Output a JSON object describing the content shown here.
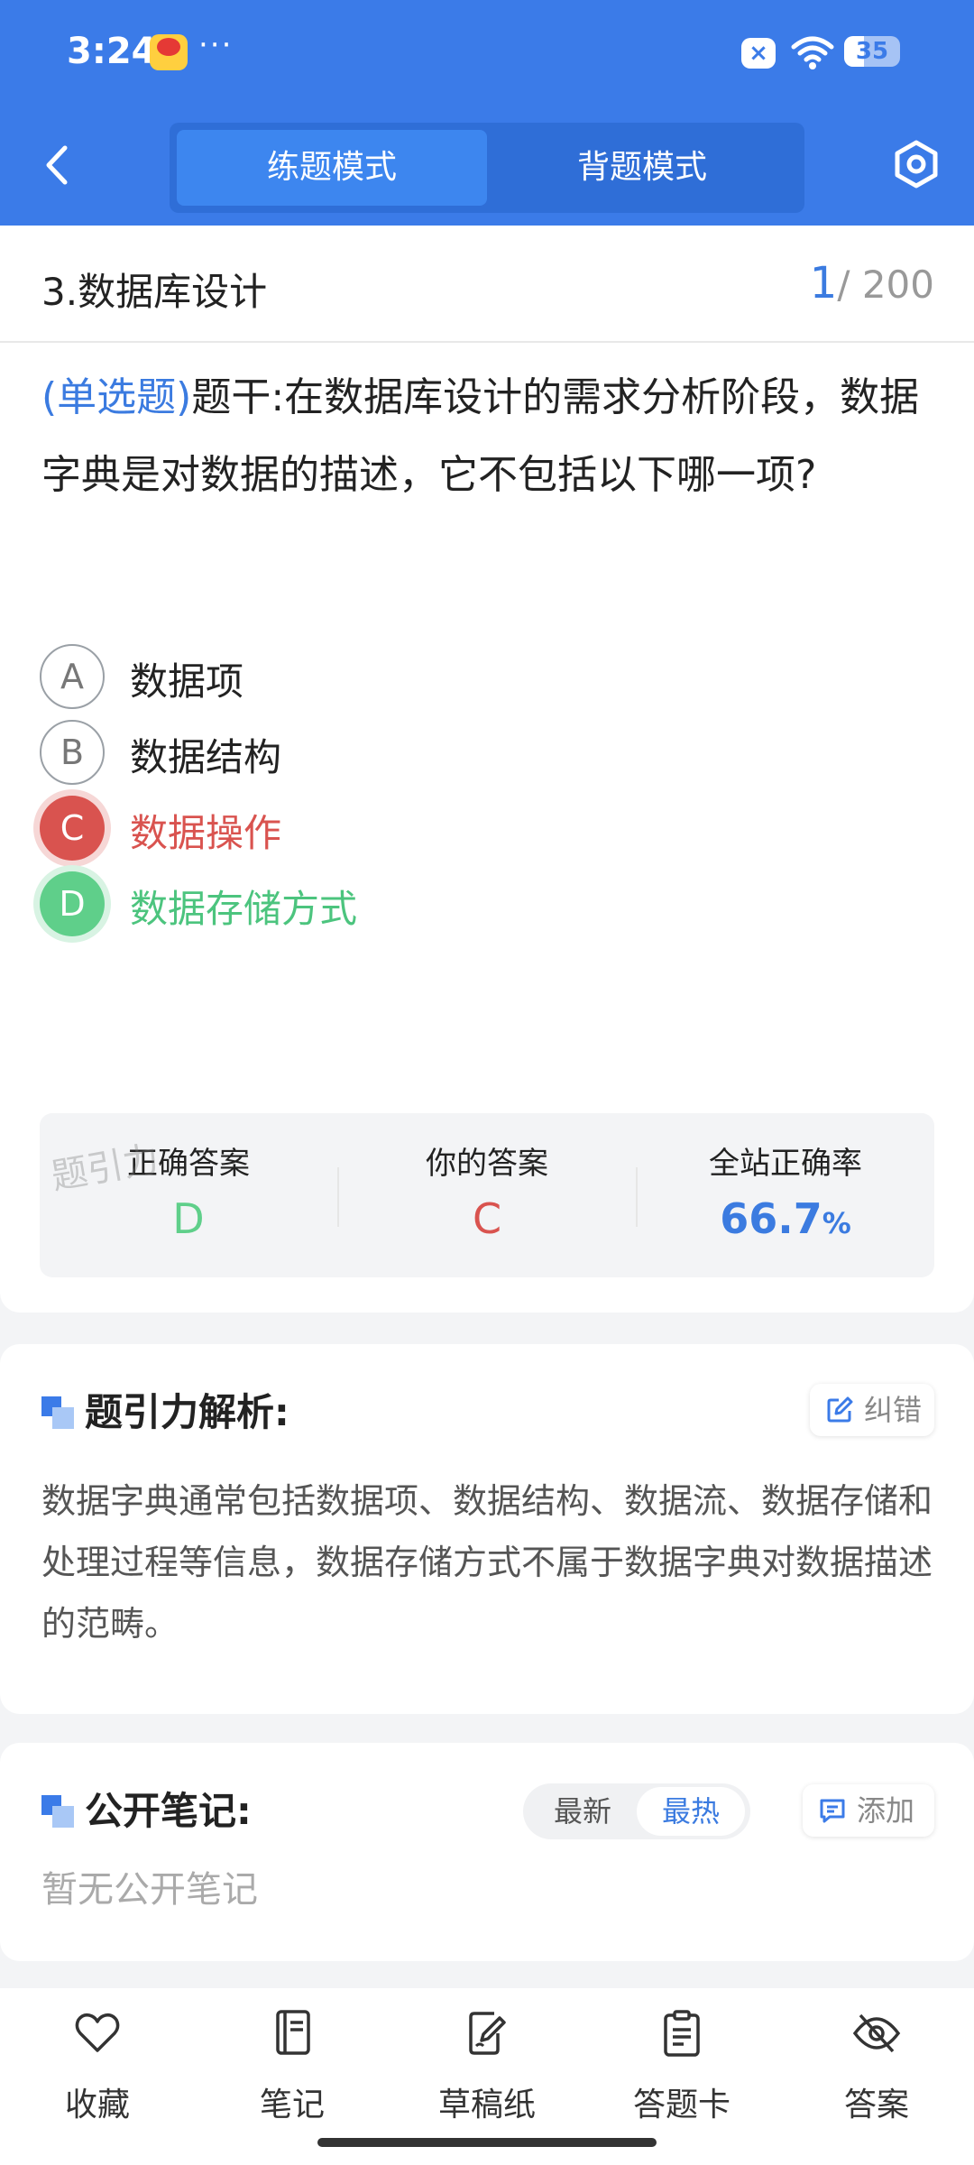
{
  "status_bar": {
    "time": "3:24",
    "dots": "···",
    "battery": "35"
  },
  "header": {
    "tabs": [
      {
        "label": "练题模式",
        "active": true
      },
      {
        "label": "背题模式",
        "active": false
      }
    ]
  },
  "question": {
    "chapter": "3.数据库设计",
    "current": "1",
    "total": "/ 200",
    "type": "(单选题)",
    "stem": "题干:在数据库设计的需求分析阶段，数据字典是对数据的描述，它不包括以下哪一项?",
    "options": [
      {
        "letter": "A",
        "text": "数据项",
        "state": "normal"
      },
      {
        "letter": "B",
        "text": "数据结构",
        "state": "normal"
      },
      {
        "letter": "C",
        "text": "数据操作",
        "state": "wrong"
      },
      {
        "letter": "D",
        "text": "数据存储方式",
        "state": "correct"
      }
    ],
    "summary": {
      "correct_label": "正确答案",
      "correct_value": "D",
      "yours_label": "你的答案",
      "yours_value": "C",
      "rate_label": "全站正确率",
      "rate_value": "66.7",
      "rate_unit": "%"
    },
    "watermark": "题引力"
  },
  "analysis": {
    "title": "题引力解析:",
    "report_label": "纠错",
    "text": "数据字典通常包括数据项、数据结构、数据流、数据存储和处理过程等信息，数据存储方式不属于数据字典对数据描述的范畴。"
  },
  "notes": {
    "title": "公开笔记:",
    "sort_options": [
      "最新",
      "最热"
    ],
    "sort_selected": "最热",
    "add_label": "添加",
    "empty_text": "暂无公开笔记"
  },
  "bottom_nav": [
    {
      "label": "收藏",
      "icon": "heart-icon"
    },
    {
      "label": "笔记",
      "icon": "notebook-icon"
    },
    {
      "label": "草稿纸",
      "icon": "draft-icon"
    },
    {
      "label": "答题卡",
      "icon": "answer-card-icon"
    },
    {
      "label": "答案",
      "icon": "eye-off-icon"
    }
  ],
  "colors": {
    "primary": "#3b7be8",
    "wrong": "#d9534f",
    "correct": "#5fcf8a"
  }
}
